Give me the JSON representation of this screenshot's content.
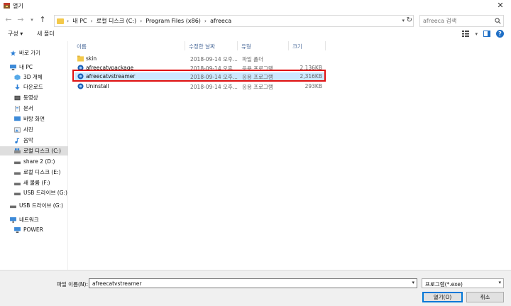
{
  "window": {
    "title": "열기"
  },
  "address": {
    "crumbs": [
      "내 PC",
      "로컬 디스크 (C:)",
      "Program Files (x86)",
      "afreeca"
    ]
  },
  "search": {
    "placeholder": "afreeca 검색"
  },
  "toolbar": {
    "organize": "구성 ▾",
    "new_folder": "새 폴더"
  },
  "sidebar": {
    "items": [
      {
        "label": "바로 가기",
        "icon": "star-icon"
      },
      {
        "label": "내 PC",
        "icon": "pc-icon"
      },
      {
        "label": "3D 개체",
        "icon": "cube-icon"
      },
      {
        "label": "다운로드",
        "icon": "download-icon"
      },
      {
        "label": "동영상",
        "icon": "video-icon"
      },
      {
        "label": "문서",
        "icon": "document-icon"
      },
      {
        "label": "바탕 화면",
        "icon": "desktop-icon"
      },
      {
        "label": "사진",
        "icon": "picture-icon"
      },
      {
        "label": "음악",
        "icon": "music-icon"
      },
      {
        "label": "로컬 디스크 (C:)",
        "icon": "drive-icon"
      },
      {
        "label": "share 2 (D:)",
        "icon": "drive-icon"
      },
      {
        "label": "로컬 디스크 (E:)",
        "icon": "drive-icon"
      },
      {
        "label": "새 볼륨 (F:)",
        "icon": "drive-icon"
      },
      {
        "label": "USB 드라이브 (G:)",
        "icon": "drive-icon"
      },
      {
        "label": "USB 드라이브 (G:)",
        "icon": "drive-icon"
      },
      {
        "label": "네트워크",
        "icon": "network-icon"
      },
      {
        "label": "POWER",
        "icon": "pc-icon"
      }
    ]
  },
  "columns": {
    "name": "이름",
    "date": "수정한 날짜",
    "type": "유형",
    "size": "크기"
  },
  "files": [
    {
      "name": "skin",
      "date": "2018-09-14 오후...",
      "type": "파일 폴더",
      "size": "",
      "icon": "folder-icon"
    },
    {
      "name": "afreecatvpackage",
      "date": "2018-09-14 오후...",
      "type": "응용 프로그램",
      "size": "2,136KB",
      "icon": "app-icon"
    },
    {
      "name": "afreecatvstreamer",
      "date": "2018-09-14 오후...",
      "type": "응용 프로그램",
      "size": "2,316KB",
      "icon": "app-icon"
    },
    {
      "name": "Uninstall",
      "date": "2018-09-14 오후...",
      "type": "응용 프로그램",
      "size": "293KB",
      "icon": "app-icon"
    }
  ],
  "footer": {
    "filename_label": "파일 이름(N):",
    "filename_value": "afreecatvstreamer",
    "filetype_value": "프로그램(*.exe)",
    "open_label": "열기(O)",
    "cancel_label": "취소"
  },
  "colors": {
    "accent": "#0078d7",
    "highlight_box": "#e01010",
    "selected_row": "#cce8ff",
    "folder": "#f3c94b"
  }
}
